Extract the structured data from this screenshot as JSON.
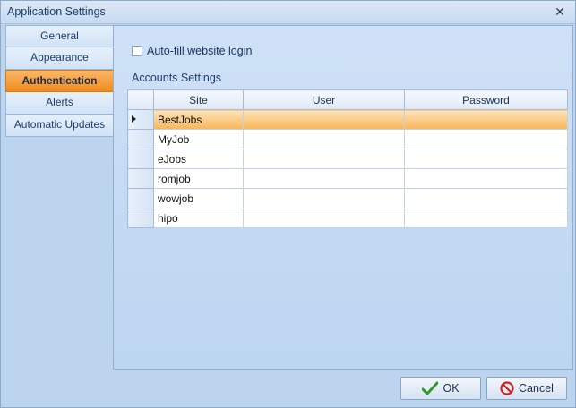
{
  "window": {
    "title": "Application Settings"
  },
  "nav": {
    "items": [
      {
        "label": "General",
        "active": false
      },
      {
        "label": "Appearance",
        "active": false
      },
      {
        "label": "Authentication",
        "active": true
      },
      {
        "label": "Alerts",
        "active": false
      },
      {
        "label": "Automatic Updates",
        "active": false
      }
    ]
  },
  "auth": {
    "autofill_label": "Auto-fill website login",
    "autofill_checked": false,
    "section_label": "Accounts Settings",
    "columns": [
      "Site",
      "User",
      "Password"
    ],
    "rows": [
      {
        "site": "BestJobs",
        "user": "",
        "password": ""
      },
      {
        "site": "MyJob",
        "user": "",
        "password": ""
      },
      {
        "site": "eJobs",
        "user": "",
        "password": ""
      },
      {
        "site": "romjob",
        "user": "",
        "password": ""
      },
      {
        "site": "wowjob",
        "user": "",
        "password": ""
      },
      {
        "site": "hipo",
        "user": "",
        "password": ""
      }
    ],
    "selected_row": 0
  },
  "buttons": {
    "ok_label": "OK",
    "cancel_label": "Cancel"
  },
  "icons": {
    "close": "close-icon",
    "ok": "checkmark-icon",
    "cancel": "cancel-circle-icon",
    "row_indicator": "row-pointer-icon"
  },
  "colors": {
    "accent": "#f08a1c",
    "window_bg": "#bcd4ee",
    "selected_row": "#f8b65a"
  }
}
